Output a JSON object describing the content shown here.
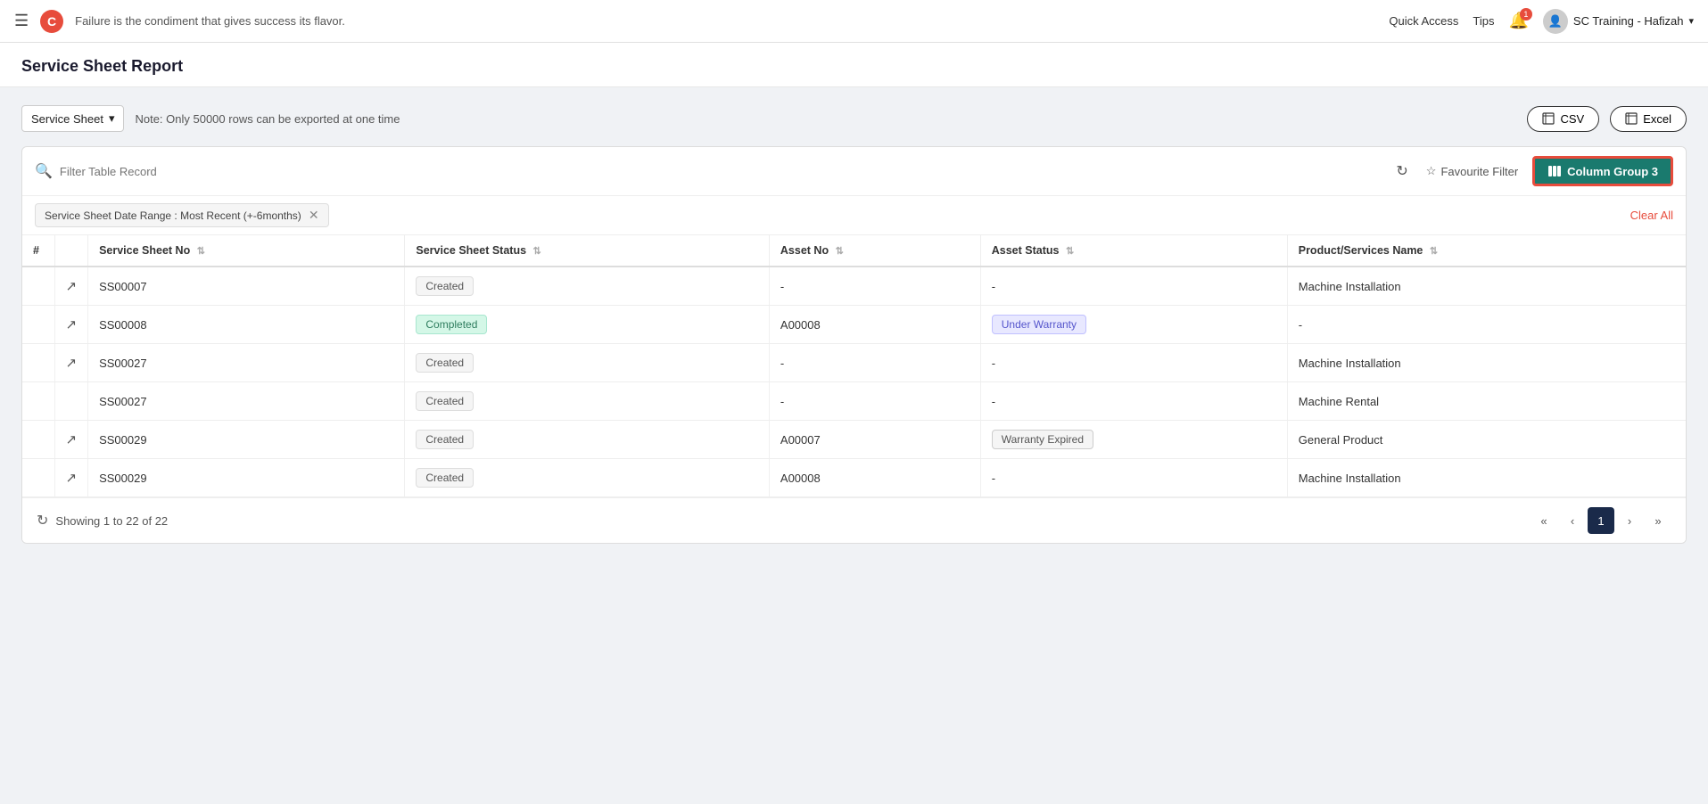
{
  "topnav": {
    "hamburger": "☰",
    "tagline": "Failure is the condiment that gives success its flavor.",
    "quick_access": "Quick Access",
    "tips": "Tips",
    "notif_count": "1",
    "user_name": "SC Training - Hafizah",
    "chevron": "▾"
  },
  "page": {
    "title": "Service Sheet Report"
  },
  "controls": {
    "dropdown_label": "Service Sheet",
    "note": "Note: Only 50000 rows can be exported at one time",
    "csv_label": "CSV",
    "excel_label": "Excel"
  },
  "filter": {
    "search_placeholder": "Filter Table Record",
    "fav_filter_label": "Favourite Filter",
    "column_group_label": "Column Group 3",
    "active_filter_tag": "Service Sheet Date Range : Most Recent (+-6months)",
    "clear_all": "Clear All"
  },
  "table": {
    "columns": [
      {
        "key": "num",
        "label": "#",
        "sortable": false
      },
      {
        "key": "ext",
        "label": "",
        "sortable": false
      },
      {
        "key": "ss_no",
        "label": "Service Sheet No",
        "sortable": true
      },
      {
        "key": "ss_status",
        "label": "Service Sheet Status",
        "sortable": true
      },
      {
        "key": "asset_no",
        "label": "Asset No",
        "sortable": true
      },
      {
        "key": "asset_status",
        "label": "Asset Status",
        "sortable": true
      },
      {
        "key": "product_name",
        "label": "Product/Services Name",
        "sortable": true
      }
    ],
    "rows": [
      {
        "num": "",
        "has_link": true,
        "ss_no": "SS00007",
        "ss_status": "Created",
        "ss_status_type": "created",
        "asset_no": "-",
        "asset_status": "-",
        "asset_status_type": "none",
        "product_name": "Machine Installation"
      },
      {
        "num": "",
        "has_link": true,
        "ss_no": "SS00008",
        "ss_status": "Completed",
        "ss_status_type": "completed",
        "asset_no": "A00008",
        "asset_status": "Under Warranty",
        "asset_status_type": "under-warranty",
        "product_name": "-"
      },
      {
        "num": "",
        "has_link": true,
        "ss_no": "SS00027",
        "ss_status": "Created",
        "ss_status_type": "created",
        "asset_no": "-",
        "asset_status": "-",
        "asset_status_type": "none",
        "product_name": "Machine Installation"
      },
      {
        "num": "",
        "has_link": false,
        "ss_no": "SS00027",
        "ss_status": "Created",
        "ss_status_type": "created",
        "asset_no": "-",
        "asset_status": "-",
        "asset_status_type": "none",
        "product_name": "Machine Rental"
      },
      {
        "num": "",
        "has_link": true,
        "ss_no": "SS00029",
        "ss_status": "Created",
        "ss_status_type": "created",
        "asset_no": "A00007",
        "asset_status": "Warranty Expired",
        "asset_status_type": "warranty-expired",
        "product_name": "General Product"
      },
      {
        "num": "",
        "has_link": true,
        "ss_no": "SS00029",
        "ss_status": "Created",
        "ss_status_type": "created",
        "asset_no": "A00008",
        "asset_status": "",
        "asset_status_type": "under-warranty",
        "product_name": "Machine Installation"
      }
    ]
  },
  "pagination": {
    "showing_text": "Showing 1 to 22 of 22",
    "current_page": "1",
    "first": "«",
    "prev": "‹",
    "next": "›",
    "last": "»"
  }
}
